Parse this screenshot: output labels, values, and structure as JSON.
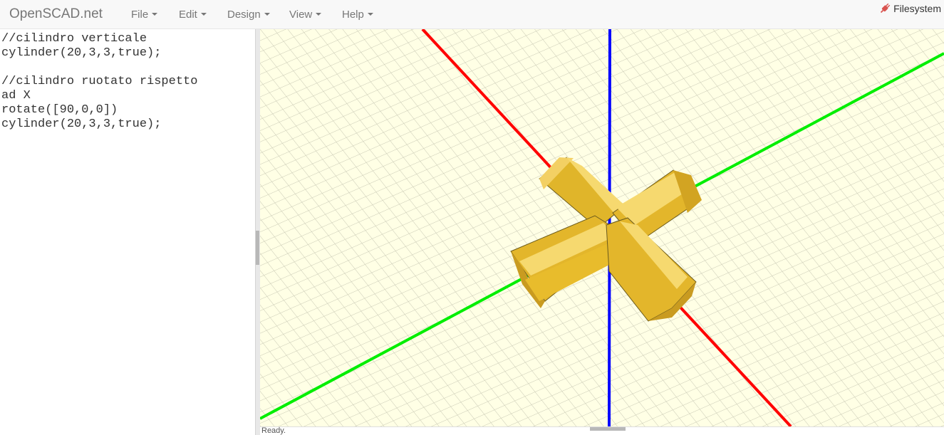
{
  "app": {
    "brand": "OpenSCAD.net"
  },
  "menu": [
    {
      "label": "File"
    },
    {
      "label": "Edit"
    },
    {
      "label": "Design"
    },
    {
      "label": "View"
    },
    {
      "label": "Help"
    }
  ],
  "filesystem": {
    "label": "Filesystem",
    "icon": "plug-icon",
    "color": "#d9534f"
  },
  "editor": {
    "lines": [
      "//cilindro verticale",
      "cylinder(20,3,3,true);",
      "",
      "//cilindro ruotato rispetto",
      "ad X",
      "rotate([90,0,0])",
      "cylinder(20,3,3,true);"
    ]
  },
  "viewport": {
    "background": "#ffffe5",
    "grid_color": "#c8c8b4",
    "axis_colors": {
      "x": "#ff0000",
      "y": "#00ee00",
      "z": "#0000ff"
    },
    "model_color": "#f9d72c"
  },
  "status": {
    "text": "Ready."
  }
}
